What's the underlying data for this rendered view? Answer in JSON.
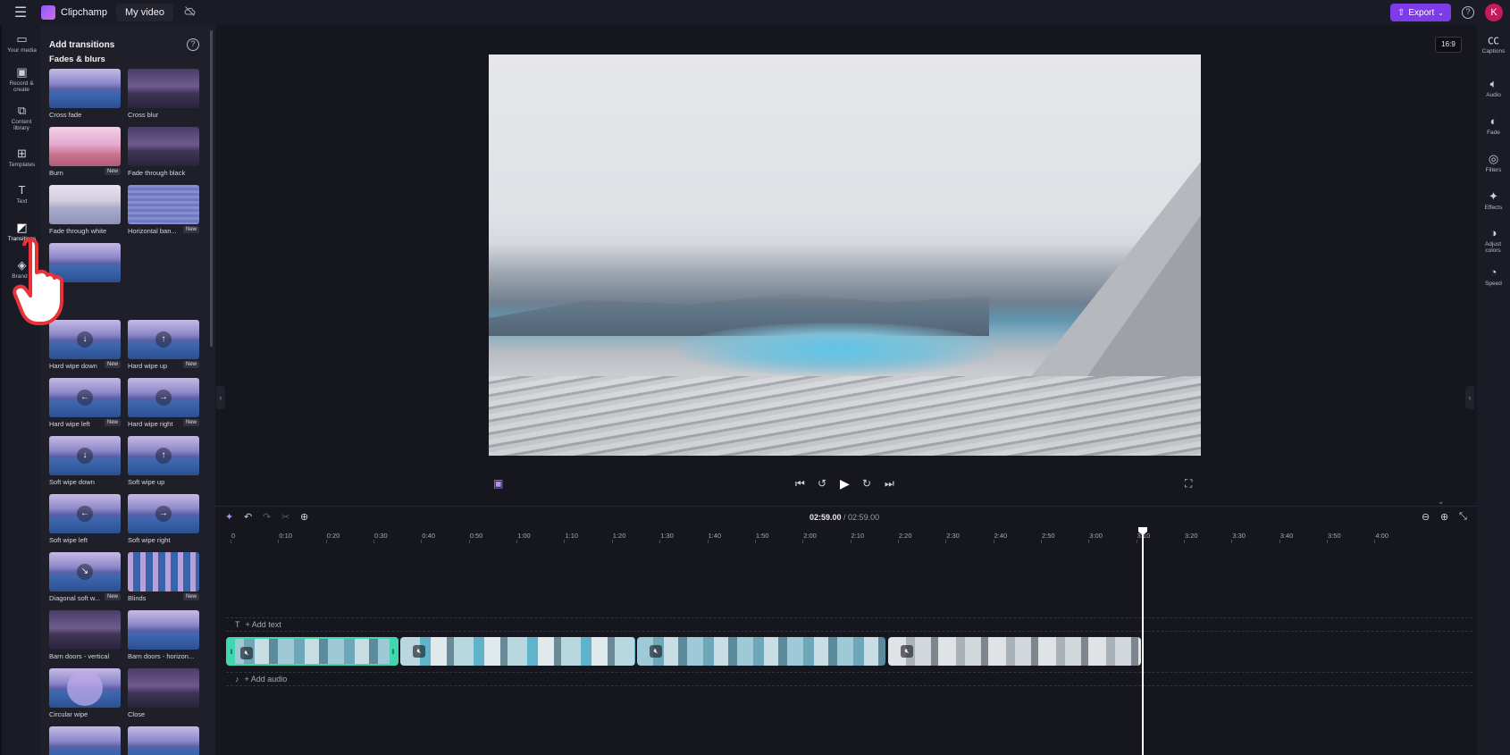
{
  "app": {
    "name": "Clipchamp",
    "project_name": "My video",
    "export_label": "Export",
    "avatar_initial": "K"
  },
  "left_nav": [
    {
      "label": "Your media",
      "icon": "folder-icon"
    },
    {
      "label": "Record & create",
      "icon": "camera-icon"
    },
    {
      "label": "Content library",
      "icon": "library-icon"
    },
    {
      "label": "Templates",
      "icon": "templates-icon"
    },
    {
      "label": "Text",
      "icon": "text-icon"
    },
    {
      "label": "Transitions",
      "icon": "transitions-icon"
    },
    {
      "label": "Brand k",
      "icon": "brand-kit-icon"
    }
  ],
  "panel": {
    "title": "Add transitions",
    "section_fades": "Fades & blurs",
    "tiles": [
      {
        "label": "Cross fade",
        "new": false
      },
      {
        "label": "Cross blur",
        "new": false
      },
      {
        "label": "Burn",
        "new": true
      },
      {
        "label": "Fade through black",
        "new": false
      },
      {
        "label": "Fade through white",
        "new": false
      },
      {
        "label": "Horizontal ban...",
        "new": true
      },
      {
        "label": "Hard wipe down",
        "new": true
      },
      {
        "label": "Hard wipe up",
        "new": true
      },
      {
        "label": "Hard wipe left",
        "new": true
      },
      {
        "label": "Hard wipe right",
        "new": true
      },
      {
        "label": "Soft wipe down",
        "new": false
      },
      {
        "label": "Soft wipe up",
        "new": false
      },
      {
        "label": "Soft wipe left",
        "new": false
      },
      {
        "label": "Soft wipe right",
        "new": false
      },
      {
        "label": "Diagonal soft w...",
        "new": true
      },
      {
        "label": "Blinds",
        "new": true
      },
      {
        "label": "Barn doors - vertical",
        "new": false
      },
      {
        "label": "Barn doors - horizon...",
        "new": false
      },
      {
        "label": "Circular wipe",
        "new": false
      },
      {
        "label": "Close",
        "new": false
      }
    ],
    "new_badge": "New"
  },
  "preview": {
    "aspect_ratio": "16:9"
  },
  "right_rail": [
    {
      "label": "Captions",
      "icon": "captions-icon"
    },
    {
      "label": "Audio",
      "icon": "audio-icon"
    },
    {
      "label": "Fade",
      "icon": "fade-icon"
    },
    {
      "label": "Filters",
      "icon": "filters-icon"
    },
    {
      "label": "Effects",
      "icon": "effects-icon"
    },
    {
      "label": "Adjust colors",
      "icon": "adjust-colors-icon"
    },
    {
      "label": "Speed",
      "icon": "speed-icon"
    }
  ],
  "timeline": {
    "current_time": "02:59.00",
    "separator": " / ",
    "total_time": "02:59.00",
    "ruler": [
      "0",
      "0:10",
      "0:20",
      "0:30",
      "0:40",
      "0:50",
      "1:00",
      "1:10",
      "1:20",
      "1:30",
      "1:40",
      "1:50",
      "2:00",
      "2:10",
      "2:20",
      "2:30",
      "2:40",
      "2:50",
      "3:00",
      "3:10",
      "3:20",
      "3:30",
      "3:40",
      "3:50",
      "4:00"
    ],
    "add_text": "+ Add text",
    "add_audio": "+ Add audio"
  },
  "colors": {
    "accent": "#7d3ce8",
    "selection": "#3fd6b0",
    "avatar": "#c41a5a"
  }
}
